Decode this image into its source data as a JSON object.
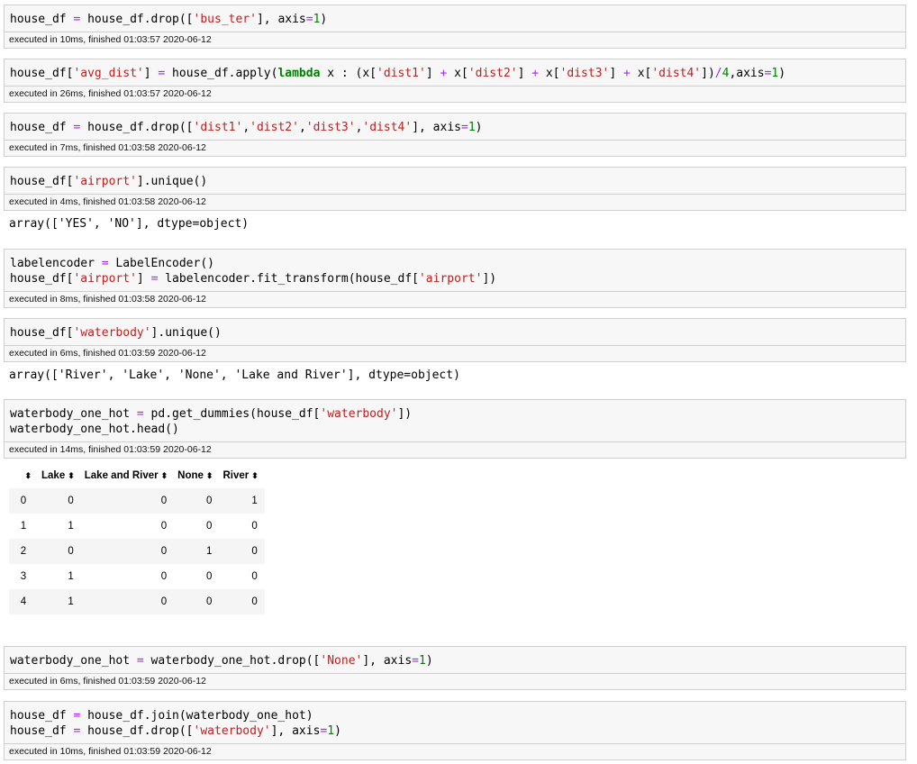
{
  "cells": [
    {
      "exec": "executed in 10ms, finished 01:03:57 2020-06-12"
    },
    {
      "exec": "executed in 26ms, finished 01:03:57 2020-06-12"
    },
    {
      "exec": "executed in 7ms, finished 01:03:58 2020-06-12"
    },
    {
      "exec": "executed in 4ms, finished 01:03:58 2020-06-12",
      "output": "array(['YES', 'NO'], dtype=object)"
    },
    {
      "exec": "executed in 8ms, finished 01:03:58 2020-06-12"
    },
    {
      "exec": "executed in 6ms, finished 01:03:59 2020-06-12",
      "output": "array(['River', 'Lake', 'None', 'Lake and River'], dtype=object)"
    },
    {
      "exec": "executed in 14ms, finished 01:03:59 2020-06-12"
    },
    {
      "exec": "executed in 6ms, finished 01:03:59 2020-06-12"
    },
    {
      "exec": "executed in 10ms, finished 01:03:59 2020-06-12"
    }
  ],
  "code": {
    "c1_a": "house_df",
    "c1_op": "=",
    "c1_b": "house_df.drop([",
    "c1_s1": "'bus_ter'",
    "c1_c": "], axis",
    "c1_op2": "=",
    "c1_n": "1",
    "c1_d": ")",
    "c2_a": "house_df[",
    "c2_s1": "'avg_dist'",
    "c2_b": "]",
    "c2_op": "=",
    "c2_c": "house_df.apply(",
    "c2_kw": "lambda",
    "c2_d": " x : (x[",
    "c2_s2": "'dist1'",
    "c2_e": "]",
    "c2_op2": "+",
    "c2_f": "x[",
    "c2_s3": "'dist2'",
    "c2_g": "]",
    "c2_op3": "+",
    "c2_h": "x[",
    "c2_s4": "'dist3'",
    "c2_i": "]",
    "c2_op4": "+",
    "c2_j": "x[",
    "c2_s5": "'dist4'",
    "c2_k": "])",
    "c2_op5": "/",
    "c2_n1": "4",
    "c2_l": ",axis",
    "c2_op6": "=",
    "c2_n2": "1",
    "c2_m": ")",
    "c3_a": "house_df",
    "c3_op": "=",
    "c3_b": "house_df.drop([",
    "c3_s1": "'dist1'",
    "c3_s2": "'dist2'",
    "c3_s3": "'dist3'",
    "c3_s4": "'dist4'",
    "c3_c": "], axis",
    "c3_op2": "=",
    "c3_n": "1",
    "c3_d": ")",
    "c4_a": "house_df[",
    "c4_s1": "'airport'",
    "c4_b": "].unique()",
    "c5_a": "labelencoder",
    "c5_op": "=",
    "c5_b": "LabelEncoder()",
    "c5_c": "house_df[",
    "c5_s1": "'airport'",
    "c5_d": "]",
    "c5_op2": "=",
    "c5_e": "labelencoder.fit_transform(house_df[",
    "c5_s2": "'airport'",
    "c5_f": "])",
    "c6_a": "house_df[",
    "c6_s1": "'waterbody'",
    "c6_b": "].unique()",
    "c7_a": "waterbody_one_hot",
    "c7_op": "=",
    "c7_b": "pd.get_dummies(house_df[",
    "c7_s1": "'waterbody'",
    "c7_c": "])",
    "c7_d": "waterbody_one_hot.head()",
    "c8_a": "waterbody_one_hot",
    "c8_op": "=",
    "c8_b": "waterbody_one_hot.drop([",
    "c8_s1": "'None'",
    "c8_c": "], axis",
    "c8_op2": "=",
    "c8_n": "1",
    "c8_d": ")",
    "c9_a": "house_df",
    "c9_op": "=",
    "c9_b": "house_df.join(waterbody_one_hot)",
    "c9_c": "house_df",
    "c9_op2": "=",
    "c9_d": "house_df.drop([",
    "c9_s1": "'waterbody'",
    "c9_e": "], axis",
    "c9_op3": "=",
    "c9_n": "1",
    "c9_f": ")"
  },
  "dataframe": {
    "sort_glyph": "⬍",
    "columns": [
      "Lake",
      "Lake and River",
      "None",
      "River"
    ],
    "rows": [
      {
        "index": "0",
        "values": [
          "0",
          "0",
          "0",
          "1"
        ]
      },
      {
        "index": "1",
        "values": [
          "1",
          "0",
          "0",
          "0"
        ]
      },
      {
        "index": "2",
        "values": [
          "0",
          "0",
          "1",
          "0"
        ]
      },
      {
        "index": "3",
        "values": [
          "1",
          "0",
          "0",
          "0"
        ]
      },
      {
        "index": "4",
        "values": [
          "1",
          "0",
          "0",
          "0"
        ]
      }
    ]
  }
}
